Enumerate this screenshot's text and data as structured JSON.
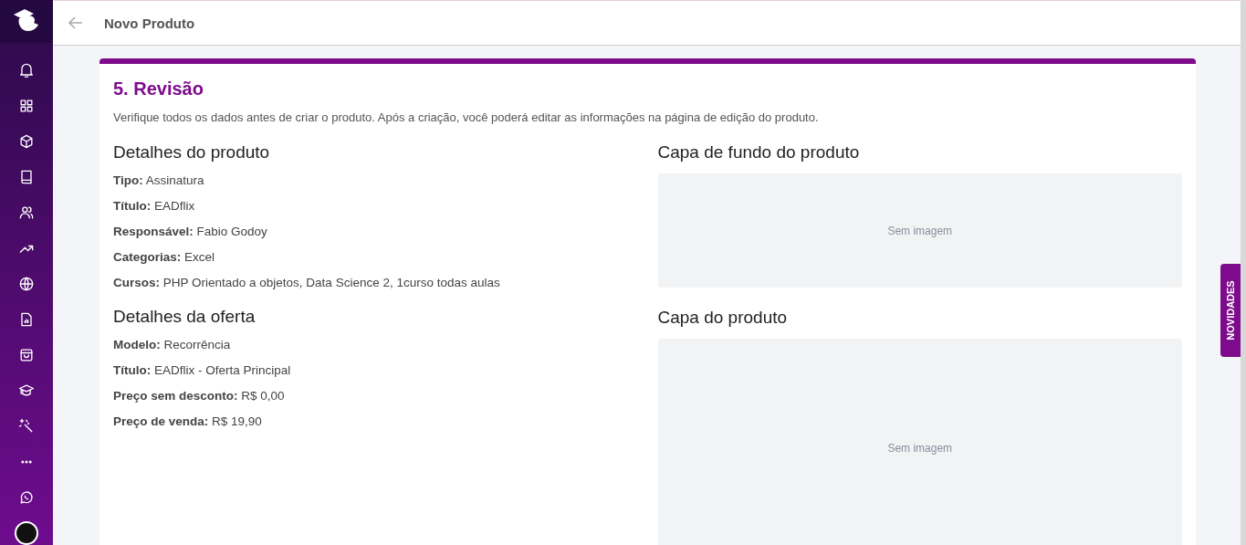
{
  "header": {
    "title": "Novo Produto"
  },
  "step": {
    "title": "5. Revisão",
    "description": "Verifique todos os dados antes de criar o produto. Após a criação, você poderá editar as informações na página de edição do produto."
  },
  "sections": [
    {
      "title": "Detalhes do produto",
      "fields": [
        "**Tipo:** Assinatura",
        "**Título:** EADflix",
        "**Responsável:** Fabio Godoy",
        "**Categorias:** Excel",
        "**Cursos:** PHP Orientado a objetos, Data Science 2, 1curso todas aulas"
      ]
    },
    {
      "title": "Detalhes da oferta",
      "fields": [
        "**Modelo:** Recorrência",
        "**Título:** EADflix - Oferta Principal",
        "**Preço sem desconto:** R$ 0,00",
        "**Preço de venda:** R$ 19,90"
      ]
    }
  ],
  "images": [
    {
      "title": "Capa de fundo do produto",
      "placeholder": "Sem imagem"
    },
    {
      "title": "Capa do produto",
      "placeholder": "Sem imagem"
    }
  ],
  "news_tab": "NOVIDADES"
}
